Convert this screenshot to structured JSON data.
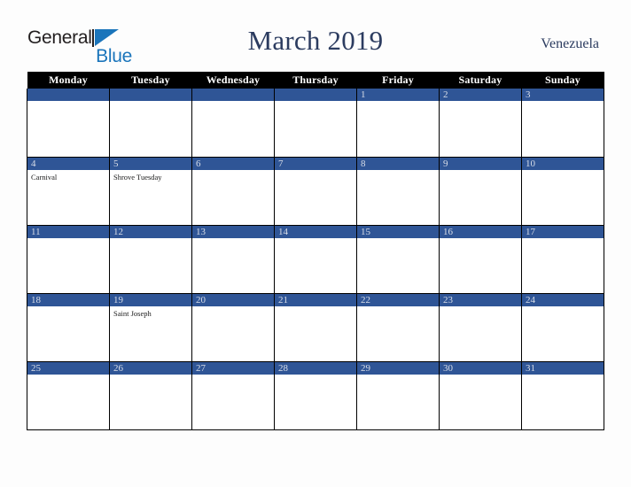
{
  "brand": {
    "name_part1": "General",
    "name_part2": "Blue",
    "mark": "triangle-logo"
  },
  "header": {
    "title": "March 2019",
    "country": "Venezuela"
  },
  "calendar": {
    "weekday_headers": [
      "Monday",
      "Tuesday",
      "Wednesday",
      "Thursday",
      "Friday",
      "Saturday",
      "Sunday"
    ],
    "colors": {
      "daybar": "#2f5596",
      "header_row": "#000000",
      "title_text": "#2c3c60",
      "brand_blue": "#1b75bb",
      "day_number_text": "#d9dee8"
    },
    "weeks": [
      [
        {
          "day": "",
          "events": []
        },
        {
          "day": "",
          "events": []
        },
        {
          "day": "",
          "events": []
        },
        {
          "day": "",
          "events": []
        },
        {
          "day": "1",
          "events": []
        },
        {
          "day": "2",
          "events": []
        },
        {
          "day": "3",
          "events": []
        }
      ],
      [
        {
          "day": "4",
          "events": [
            "Carnival"
          ]
        },
        {
          "day": "5",
          "events": [
            "Shrove Tuesday"
          ]
        },
        {
          "day": "6",
          "events": []
        },
        {
          "day": "7",
          "events": []
        },
        {
          "day": "8",
          "events": []
        },
        {
          "day": "9",
          "events": []
        },
        {
          "day": "10",
          "events": []
        }
      ],
      [
        {
          "day": "11",
          "events": []
        },
        {
          "day": "12",
          "events": []
        },
        {
          "day": "13",
          "events": []
        },
        {
          "day": "14",
          "events": []
        },
        {
          "day": "15",
          "events": []
        },
        {
          "day": "16",
          "events": []
        },
        {
          "day": "17",
          "events": []
        }
      ],
      [
        {
          "day": "18",
          "events": []
        },
        {
          "day": "19",
          "events": [
            "Saint Joseph"
          ]
        },
        {
          "day": "20",
          "events": []
        },
        {
          "day": "21",
          "events": []
        },
        {
          "day": "22",
          "events": []
        },
        {
          "day": "23",
          "events": []
        },
        {
          "day": "24",
          "events": []
        }
      ],
      [
        {
          "day": "25",
          "events": []
        },
        {
          "day": "26",
          "events": []
        },
        {
          "day": "27",
          "events": []
        },
        {
          "day": "28",
          "events": []
        },
        {
          "day": "29",
          "events": []
        },
        {
          "day": "30",
          "events": []
        },
        {
          "day": "31",
          "events": []
        }
      ]
    ]
  }
}
